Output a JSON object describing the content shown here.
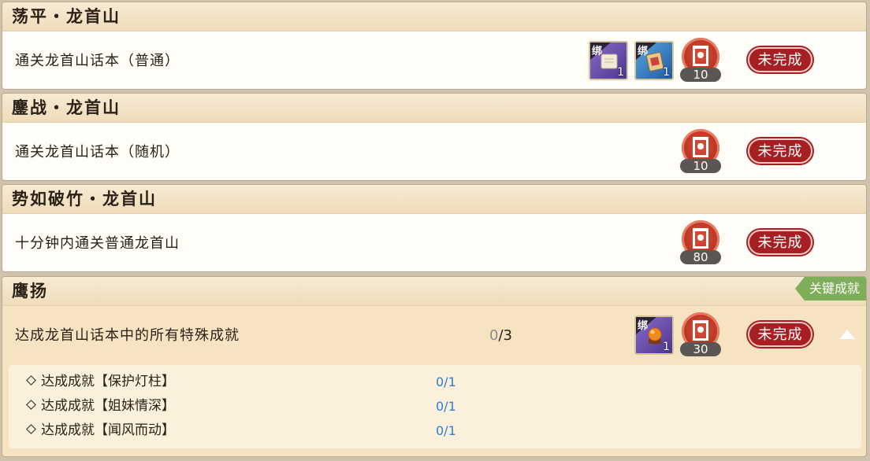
{
  "achievements": [
    {
      "title": "荡平・龙首山",
      "desc": "通关龙首山话本（普通）",
      "points": "10",
      "status": "未完成",
      "rewards": [
        {
          "bind": "绑",
          "qty": "1",
          "icon": "scroll-icon"
        },
        {
          "bind": "绑",
          "qty": "1",
          "icon": "ticket-icon"
        }
      ]
    },
    {
      "title": "鏖战・龙首山",
      "desc": "通关龙首山话本（随机）",
      "points": "10",
      "status": "未完成"
    },
    {
      "title": "势如破竹・龙首山",
      "desc": "十分钟内通关普通龙首山",
      "points": "80",
      "status": "未完成"
    },
    {
      "title": "鹰扬",
      "tag": "关键成就",
      "desc": "达成龙首山话本中的所有特殊成就",
      "progress_current": "0",
      "progress_total": "/3",
      "points": "30",
      "status": "未完成",
      "rewards": [
        {
          "bind": "绑",
          "qty": "1",
          "icon": "orb-icon"
        }
      ],
      "sub_items": [
        {
          "label": "达成成就【保护灯柱】",
          "value": "0/1"
        },
        {
          "label": "达成成就【姐妹情深】",
          "value": "0/1"
        },
        {
          "label": "达成成就【闻风而动】",
          "value": "0/1"
        }
      ]
    }
  ],
  "colors": {
    "status_red": "#a81f23",
    "key_tag_green": "#7fae5a",
    "sub_progress_blue": "#2f7fd0",
    "header_gold": "#efdcba"
  }
}
